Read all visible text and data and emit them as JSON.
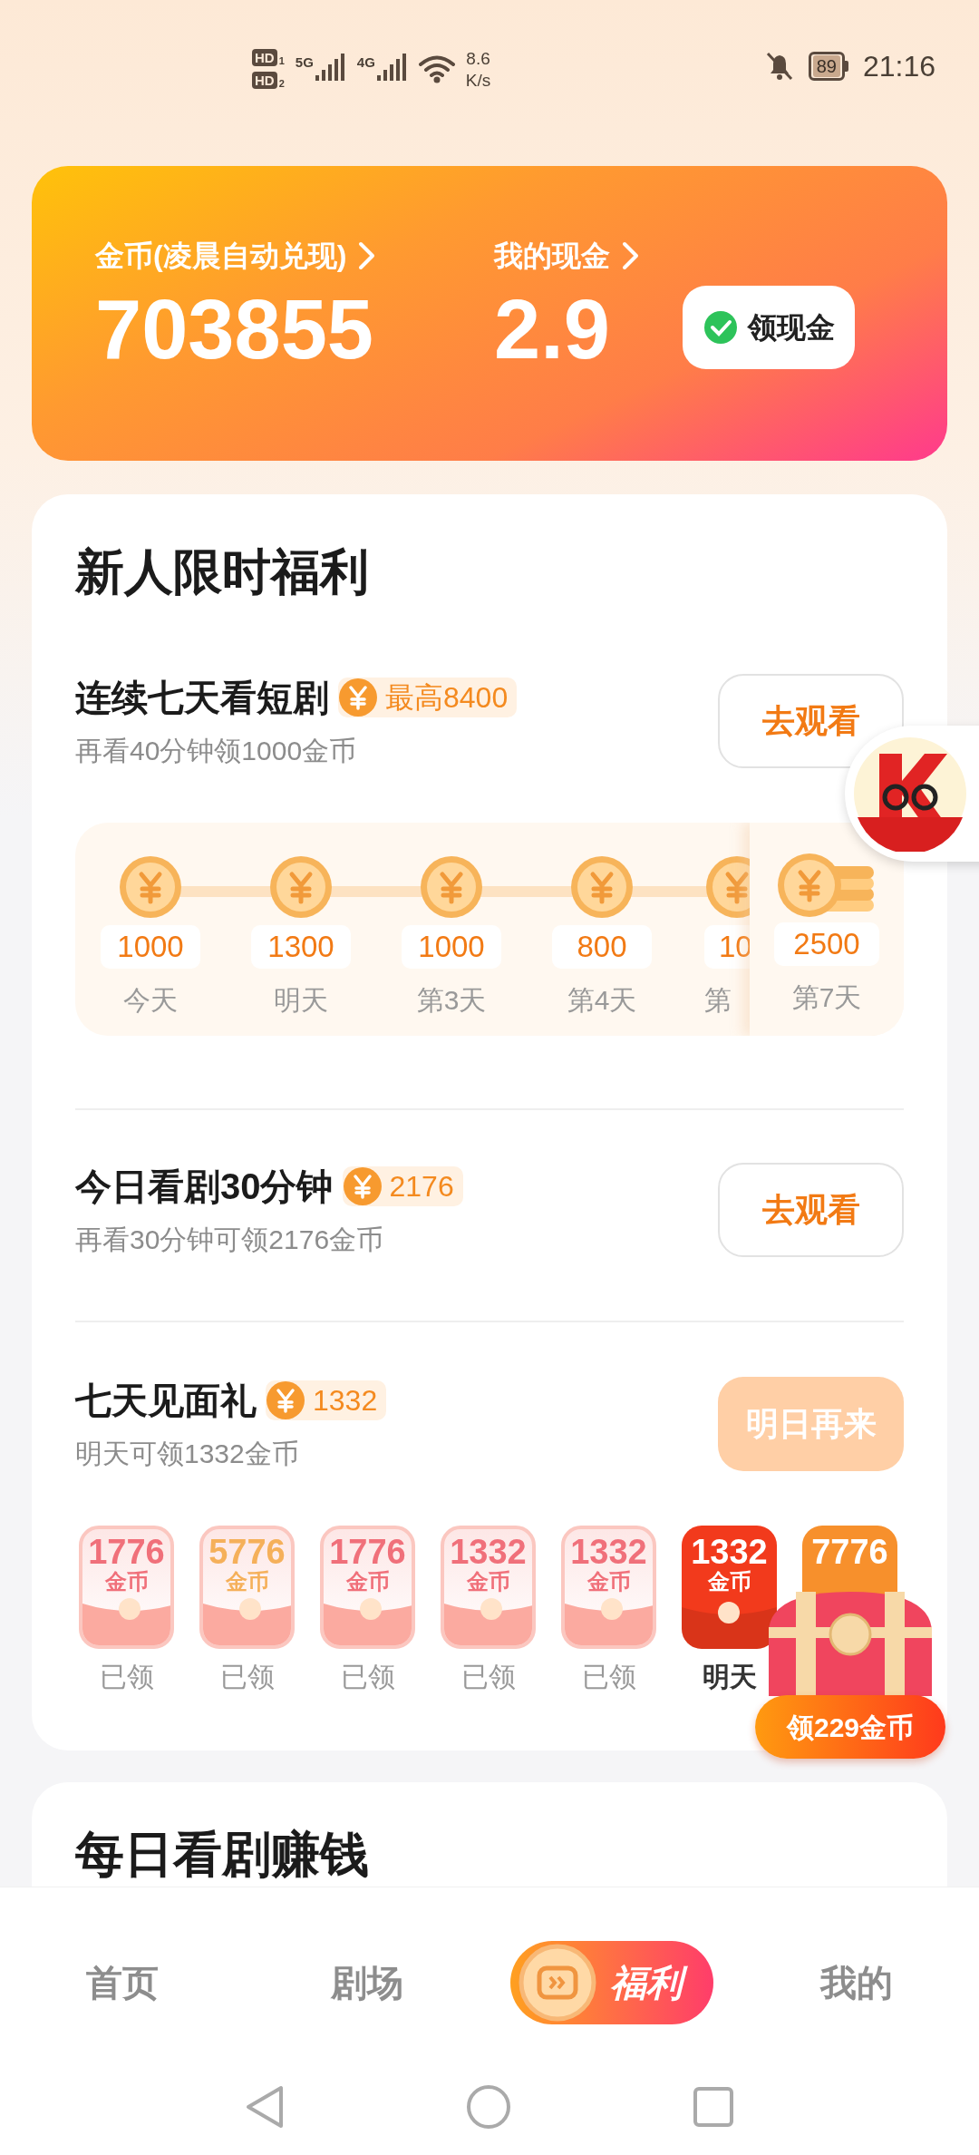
{
  "status_bar": {
    "sims": [
      {
        "label": "HD",
        "slot": "1"
      },
      {
        "label": "HD",
        "slot": "2"
      }
    ],
    "networks": [
      "5G",
      "4G"
    ],
    "speed_value": "8.6",
    "speed_unit": "K/s",
    "battery": "89",
    "time": "21:16"
  },
  "wallet": {
    "coins_label": "金币(凌晨自动兑现)",
    "coins": "703855",
    "cash_label": "我的现金",
    "cash": "2.9",
    "withdraw_button": "领现金"
  },
  "newcomer": {
    "title": "新人限时福利",
    "tasks": [
      {
        "title": "连续七天看短剧",
        "reward": "最高8400",
        "subtitle": "再看40分钟领1000金币",
        "button": "去观看",
        "disabled": false
      },
      {
        "title": "今日看剧30分钟",
        "reward": "2176",
        "subtitle": "再看30分钟可领2176金币",
        "button": "去观看",
        "disabled": false
      },
      {
        "title": "七天见面礼",
        "reward": "1332",
        "subtitle": "明天可领1332金币",
        "button": "明日再来",
        "disabled": true
      }
    ],
    "streak_days": [
      {
        "amount": "1000",
        "label": "今天",
        "kind": "normal"
      },
      {
        "amount": "1300",
        "label": "明天",
        "kind": "normal"
      },
      {
        "amount": "1000",
        "label": "第3天",
        "kind": "normal"
      },
      {
        "amount": "800",
        "label": "第4天",
        "kind": "normal"
      },
      {
        "amount": "10",
        "label": "第",
        "kind": "partial"
      },
      {
        "amount": "2500",
        "label": "第7天",
        "kind": "final"
      }
    ],
    "gift_packets": [
      {
        "amount": "1776",
        "unit": "金币",
        "label": "已领",
        "kind": "claimed",
        "color": "#f0707a"
      },
      {
        "amount": "5776",
        "unit": "金币",
        "label": "已领",
        "kind": "claimed",
        "color": "#f5b05a"
      },
      {
        "amount": "1776",
        "unit": "金币",
        "label": "已领",
        "kind": "claimed",
        "color": "#f0707a"
      },
      {
        "amount": "1332",
        "unit": "金币",
        "label": "已领",
        "kind": "claimed",
        "color": "#f0707a"
      },
      {
        "amount": "1332",
        "unit": "金币",
        "label": "已领",
        "kind": "claimed",
        "color": "#f0707a"
      },
      {
        "amount": "1332",
        "unit": "金币",
        "label": "明天",
        "kind": "next",
        "color": "#f23a1c"
      },
      {
        "amount": "7776",
        "kind": "future",
        "color": "#f7902c"
      }
    ],
    "chest_button": "领229金币"
  },
  "daily": {
    "title": "每日看剧赚钱"
  },
  "tabs": [
    {
      "label": "首页",
      "selected": false
    },
    {
      "label": "剧场",
      "selected": false
    },
    {
      "label": "福利",
      "selected": true
    },
    {
      "label": "我的",
      "selected": false
    }
  ]
}
